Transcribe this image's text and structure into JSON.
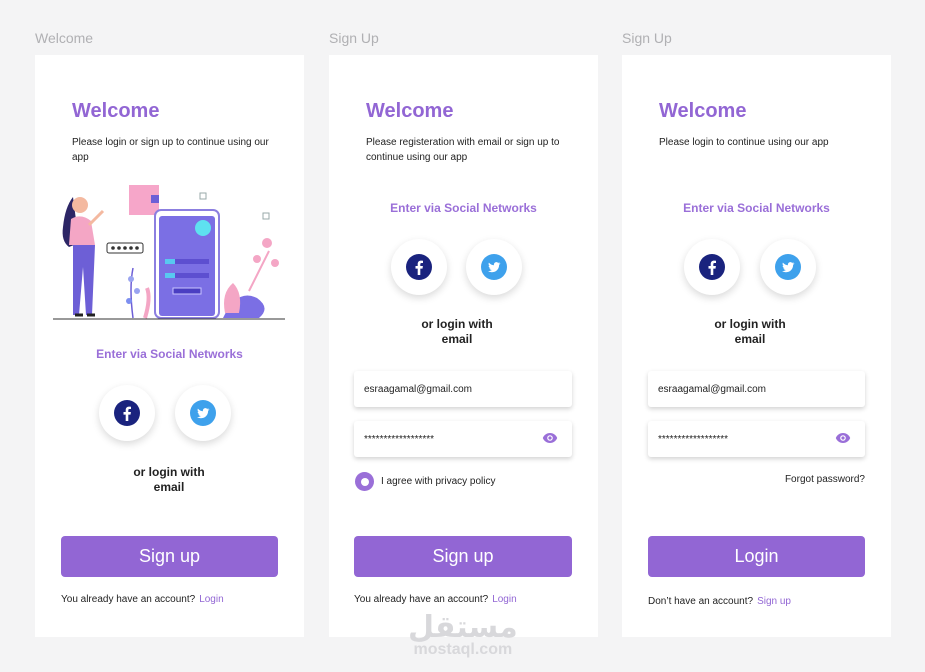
{
  "frames": [
    {
      "label": "Welcome",
      "title": "Welcome",
      "subtitle": "Please login or sign up to continue using our app",
      "social_heading": "Enter via Social Networks",
      "or_login": "or login with email",
      "button": "Sign up",
      "footer_text": "You already have an account?",
      "footer_link": "Login"
    },
    {
      "label": "Sign Up",
      "title": "Welcome",
      "subtitle": "Please registeration with email or sign up to continue using our app",
      "social_heading": "Enter via Social Networks",
      "or_login": "or login with email",
      "email": "esraagamal@gmail.com",
      "password": "******************",
      "privacy": "I agree with privacy policy",
      "button": "Sign up",
      "footer_text": "You already have an account?",
      "footer_link": "Login"
    },
    {
      "label": "Sign Up",
      "title": "Welcome",
      "subtitle": "Please login to continue using our app",
      "social_heading": "Enter via Social Networks",
      "or_login": "or login with email",
      "email": "esraagamal@gmail.com",
      "password": "******************",
      "forgot": "Forgot password?",
      "button": "Login",
      "footer_text": "Don’t have an account?",
      "footer_link": "Sign up"
    }
  ],
  "watermark": {
    "arabic": "مستقل",
    "latin": "mostaql.com"
  },
  "colors": {
    "accent": "#9266d4",
    "facebook": "#1a237e",
    "twitter": "#3ea1ec",
    "background": "#f4f4f5"
  },
  "icons": [
    "facebook-icon",
    "twitter-icon",
    "eye-icon"
  ]
}
